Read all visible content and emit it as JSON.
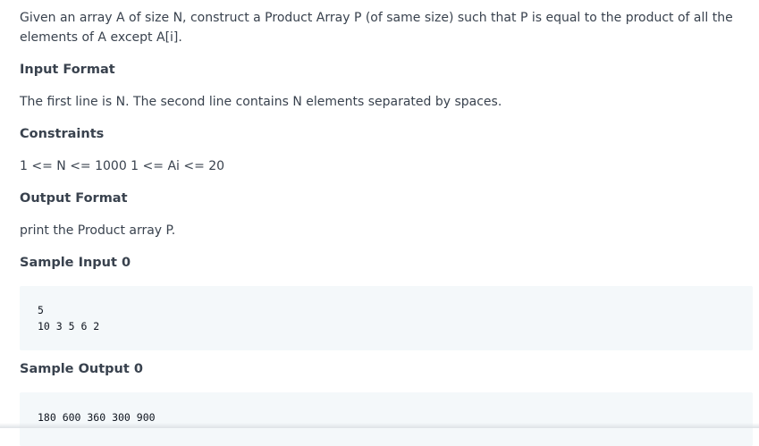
{
  "problem": {
    "intro": "Given an array A of size N, construct a Product Array P (of same size) such that P is equal to the product of all the elements of A except A[i].",
    "input_format": {
      "heading": "Input Format",
      "text": "The first line is N. The second line contains N elements separated by spaces."
    },
    "constraints": {
      "heading": "Constraints",
      "text": "1 <= N <= 1000 1 <= Ai <= 20"
    },
    "output_format": {
      "heading": "Output Format",
      "text": "print the Product array P."
    },
    "sample_input": {
      "heading": "Sample Input 0",
      "lines": [
        "5",
        "10 3 5 6 2"
      ]
    },
    "sample_output": {
      "heading": "Sample Output 0",
      "lines": [
        "180 600 360 300 900"
      ]
    }
  },
  "colors": {
    "text": "#39424e",
    "code_background": "#f4f8fa"
  }
}
